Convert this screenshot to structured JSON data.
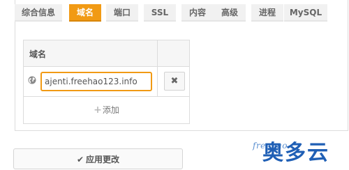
{
  "tabs": [
    {
      "label": "综合信息",
      "active": false
    },
    {
      "label": "域名",
      "active": true
    },
    {
      "label": "端口",
      "active": false
    },
    {
      "label": "SSL",
      "active": false
    },
    {
      "label": "内容",
      "active": false
    },
    {
      "label": "高级",
      "active": false
    },
    {
      "label": "进程",
      "active": false
    },
    {
      "label": "MySQL",
      "active": false
    }
  ],
  "domain_table": {
    "header": "域名",
    "rows": [
      {
        "value": "ajenti.freehao123.info",
        "row_icon": "globe-icon",
        "delete_label": "✖"
      }
    ],
    "add_label": "添加",
    "add_icon": "+"
  },
  "apply_button": {
    "label": "应用更改",
    "icon": "✔"
  },
  "watermark": {
    "small": "freehao",
    "big": "奥多云"
  },
  "colors": {
    "accent": "#f19a14",
    "watermark_blue": "#1f5fb5",
    "spell_error": "#e03030"
  }
}
